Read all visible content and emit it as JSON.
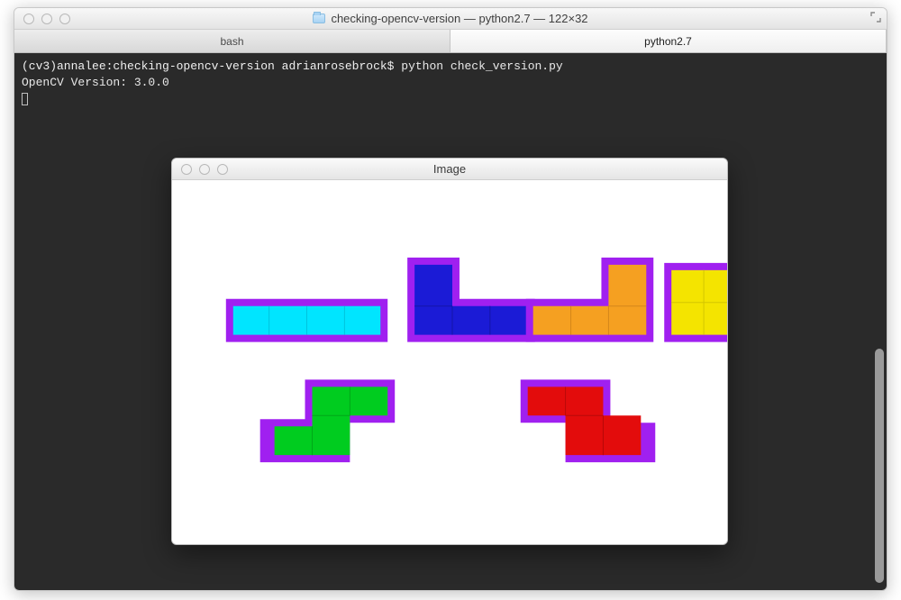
{
  "terminal": {
    "window_title": "checking-opencv-version — python2.7 — 122×32",
    "tabs": [
      {
        "label": "bash",
        "active": false
      },
      {
        "label": "python2.7",
        "active": true
      }
    ],
    "prompt": "(cv3)annalee:checking-opencv-version adrianrosebrock$ ",
    "command": "python check_version.py",
    "output_line": "OpenCV Version: 3.0.0"
  },
  "image_window": {
    "title": "Image",
    "outline_color": "#a020f0",
    "shapes": [
      {
        "name": "I-piece",
        "color": "#00e5ff"
      },
      {
        "name": "J-piece",
        "color": "#1b1bd6"
      },
      {
        "name": "L-piece",
        "color": "#f5a021"
      },
      {
        "name": "O-piece",
        "color": "#f4e400"
      },
      {
        "name": "S-piece",
        "color": "#00cc1f"
      },
      {
        "name": "Z-piece",
        "color": "#e30c0c"
      }
    ]
  }
}
